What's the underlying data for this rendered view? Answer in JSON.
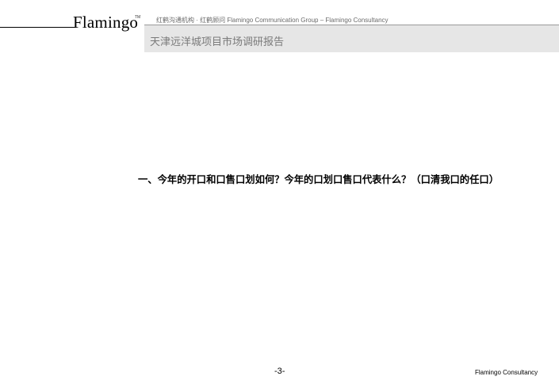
{
  "header": {
    "logo_text": "Flamingo",
    "logo_superscript": "TM",
    "tagline": "红鹤沟通机构 · 红鹤顾问 Flamingo Communication Group – Flamingo Consultancy",
    "report_title": "天津远洋城项目市场调研报告"
  },
  "main": {
    "section_heading": "一、今年的开口和口售口划如何？今年的口划口售口代表什么？（口清我口的任口）"
  },
  "footer": {
    "page_number": "-3-",
    "brand": "Flamingo Consultancy"
  }
}
